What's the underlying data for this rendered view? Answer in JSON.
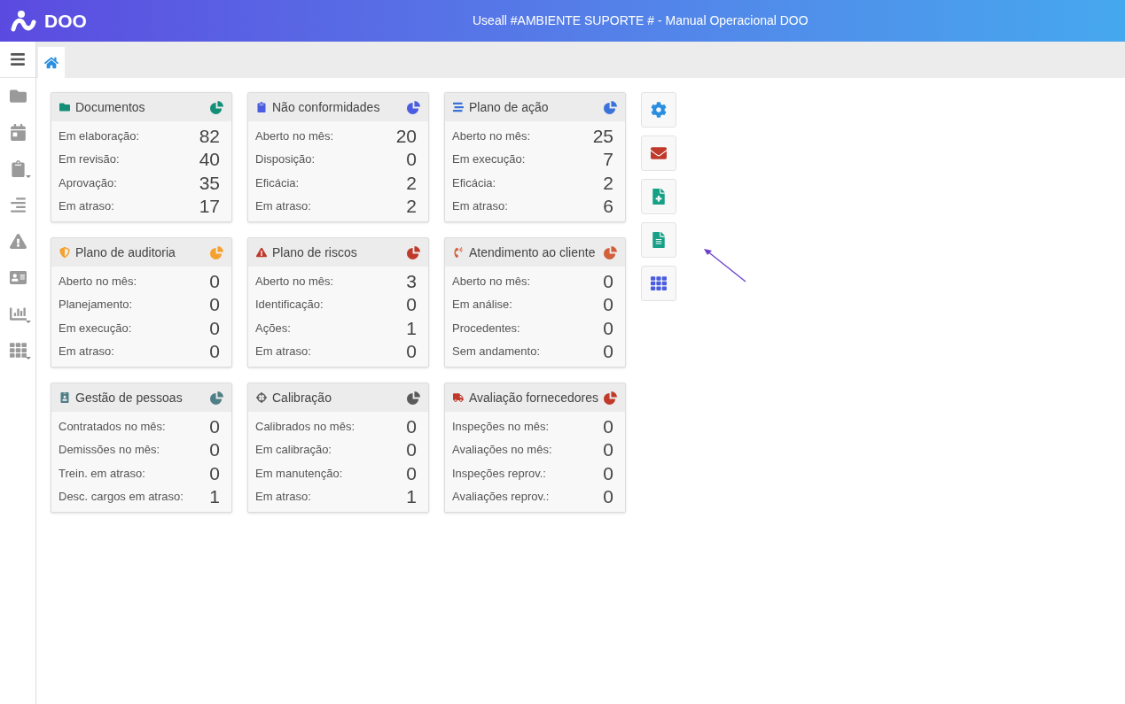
{
  "header": {
    "logo": "DOO",
    "title": "Useall #AMBIENTE SUPORTE # - Manual Operacional DOO"
  },
  "cards": [
    {
      "title": "Documentos",
      "color": "#148f77",
      "rows": [
        {
          "label": "Em elaboração:",
          "value": "82"
        },
        {
          "label": "Em revisão:",
          "value": "40"
        },
        {
          "label": "Aprovação:",
          "value": "35"
        },
        {
          "label": "Em atraso:",
          "value": "17"
        }
      ]
    },
    {
      "title": "Não conformidades",
      "color": "#4a5de0",
      "rows": [
        {
          "label": "Aberto no mês:",
          "value": "20"
        },
        {
          "label": "Disposição:",
          "value": "0"
        },
        {
          "label": "Eficácia:",
          "value": "2"
        },
        {
          "label": "Em atraso:",
          "value": "2"
        }
      ]
    },
    {
      "title": "Plano de ação",
      "color": "#3b72d9",
      "rows": [
        {
          "label": "Aberto no mês:",
          "value": "25"
        },
        {
          "label": "Em execução:",
          "value": "7"
        },
        {
          "label": "Eficácia:",
          "value": "2"
        },
        {
          "label": "Em atraso:",
          "value": "6"
        }
      ]
    },
    {
      "title": "Plano de auditoria",
      "color": "#f5a130",
      "rows": [
        {
          "label": "Aberto no mês:",
          "value": "0"
        },
        {
          "label": "Planejamento:",
          "value": "0"
        },
        {
          "label": "Em execução:",
          "value": "0"
        },
        {
          "label": "Em atraso:",
          "value": "0"
        }
      ]
    },
    {
      "title": "Plano de riscos",
      "color": "#c0392b",
      "rows": [
        {
          "label": "Aberto no mês:",
          "value": "3"
        },
        {
          "label": "Identificação:",
          "value": "0"
        },
        {
          "label": "Ações:",
          "value": "1"
        },
        {
          "label": "Em atraso:",
          "value": "0"
        }
      ]
    },
    {
      "title": "Atendimento ao cliente",
      "color": "#d35f3a",
      "rows": [
        {
          "label": "Aberto no mês:",
          "value": "0"
        },
        {
          "label": "Em análise:",
          "value": "0"
        },
        {
          "label": "Procedentes:",
          "value": "0"
        },
        {
          "label": "Sem andamento:",
          "value": "0"
        }
      ]
    },
    {
      "title": "Gestão de pessoas",
      "color": "#4f7f86",
      "rows": [
        {
          "label": "Contratados no mês:",
          "value": "0"
        },
        {
          "label": "Demissões no mês:",
          "value": "0"
        },
        {
          "label": "Trein. em atraso:",
          "value": "0"
        },
        {
          "label": "Desc. cargos em atraso:",
          "value": "1"
        }
      ]
    },
    {
      "title": "Calibração",
      "color": "#5a5a5a",
      "rows": [
        {
          "label": "Calibrados no mês:",
          "value": "0"
        },
        {
          "label": "Em calibração:",
          "value": "0"
        },
        {
          "label": "Em manutenção:",
          "value": "0"
        },
        {
          "label": "Em atraso:",
          "value": "1"
        }
      ]
    },
    {
      "title": "Avaliação fornecedores",
      "color": "#c0392b",
      "rows": [
        {
          "label": "Inspeções no mês:",
          "value": "0"
        },
        {
          "label": "Avaliações no mês:",
          "value": "0"
        },
        {
          "label": "Inspeções reprov.:",
          "value": "0"
        },
        {
          "label": "Avaliações reprov.:",
          "value": "0"
        }
      ]
    }
  ]
}
